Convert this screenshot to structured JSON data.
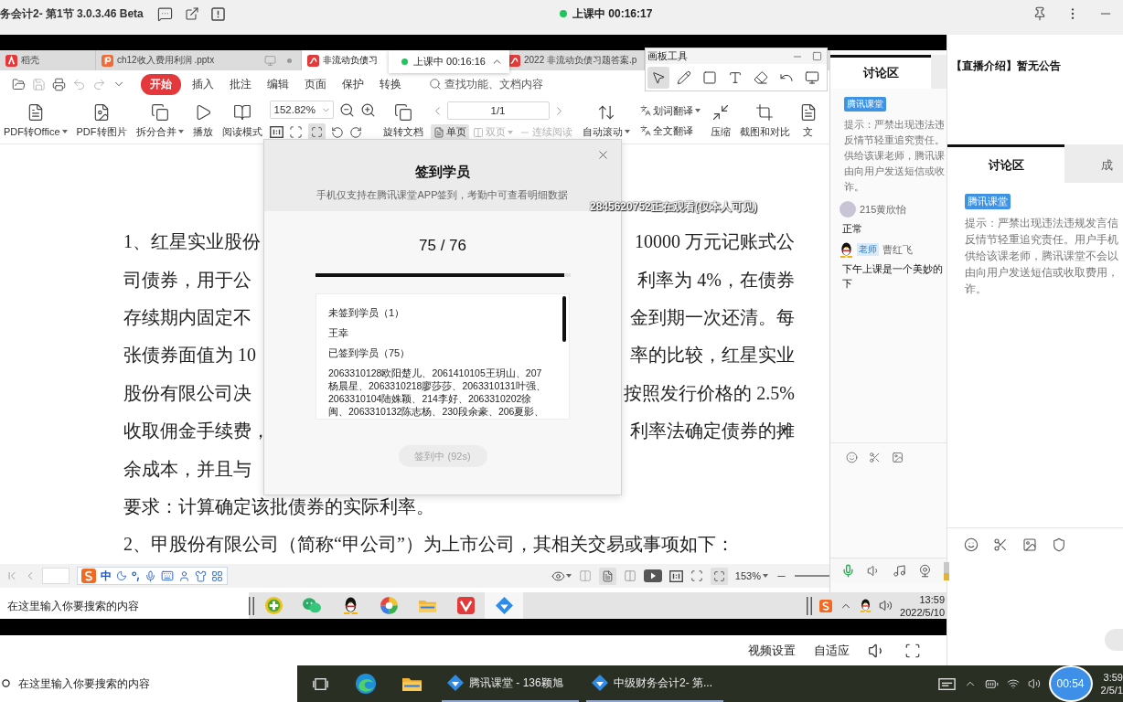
{
  "title_bar": {
    "title": "务会计2- 第1节 3.0.3.46 Beta",
    "class_status": "上课中 00:16:17"
  },
  "shared_screen": {
    "doc_tabs": [
      {
        "label": "稻壳",
        "kind": "docer",
        "selected": false
      },
      {
        "label": "ch12收入费用利润 .pptx",
        "kind": "pptx",
        "selected": false
      },
      {
        "label": "非流动负债习",
        "kind": "pdf",
        "selected": true
      },
      {
        "label": "2022 非流动负债习题答案.p",
        "kind": "pdf",
        "selected": false
      }
    ],
    "class_popup": "上课中 00:16:16",
    "menu": {
      "tabs": [
        {
          "label": "开始",
          "selected": true
        },
        {
          "label": "插入",
          "selected": false
        },
        {
          "label": "批注",
          "selected": false
        },
        {
          "label": "编辑",
          "selected": false
        },
        {
          "label": "页面",
          "selected": false
        },
        {
          "label": "保护",
          "selected": false
        },
        {
          "label": "转换",
          "selected": false
        }
      ],
      "search_placeholder": "查找功能、文档内容"
    },
    "toolbar": {
      "tools": [
        {
          "label": "PDF转Office",
          "dropdown": true
        },
        {
          "label": "PDF转图片",
          "dropdown": false
        },
        {
          "label": "拆分合并",
          "dropdown": true
        },
        {
          "label": "播放",
          "dropdown": false
        },
        {
          "label": "阅读模式",
          "dropdown": false
        }
      ],
      "zoom": "152.82%",
      "rotate_label": "旋转文档",
      "page": "1/1",
      "view_modes": [
        {
          "label": "单页",
          "selected": true,
          "disabled": false,
          "dropdown": false
        },
        {
          "label": "双页",
          "selected": false,
          "disabled": true,
          "dropdown": true
        },
        {
          "label": "连续阅读",
          "selected": false,
          "disabled": true,
          "dropdown": false
        }
      ],
      "auto_scroll": {
        "label": "自动滚动",
        "dropdown": true
      },
      "translate": [
        {
          "label": "划词翻译",
          "dropdown": true
        },
        {
          "label": "全文翻译",
          "dropdown": false
        }
      ],
      "tools_right": [
        {
          "label": "压缩"
        },
        {
          "label": "截图和对比"
        },
        {
          "label": "文"
        }
      ]
    },
    "drawing_tools": {
      "title": "画板工具",
      "tools": [
        {
          "selected": true
        },
        {
          "selected": false
        },
        {
          "selected": false
        },
        {
          "selected": false
        },
        {
          "selected": false
        },
        {
          "selected": false
        },
        {
          "selected": false
        }
      ]
    },
    "document": {
      "lines": [
        {
          "start": "1、红星实业股份",
          "end": "10000 万元记账式公"
        },
        {
          "start": "司债券，用于公",
          "end": "利率为 4%，在债券"
        },
        {
          "start": "存续期内固定不",
          "end": "金到期一次还清。每"
        },
        {
          "start": "张债券面值为 10",
          "end": "率的比较，红星实业"
        },
        {
          "start": "股份有限公司决",
          "end": "按照发行价格的 2.5%"
        },
        {
          "start": "收取佣金手续费，",
          "end": "利率法确定债券的摊"
        },
        {
          "start": "余成本，并且与"
        },
        {
          "start": "要求：计算确定该批债券的实际利率。"
        },
        {
          "start": "2、甲股份有限公司（简称“甲公司”）为上市公司，其相关交易或事项如下："
        }
      ]
    },
    "sign_in_dialog": {
      "title": "签到学员",
      "subtitle": "手机仅支持在腾讯课堂APP签到，考勤中可查看明细数据",
      "count": "75 / 76",
      "progress": {
        "level": 0.975
      },
      "absent_heading": "未签到学员（1）",
      "absent_names": "王幸",
      "present_heading": "已签到学员（75）",
      "present_lines": [
        "2063310128欧阳楚儿、2061410105王玥山、207",
        "杨晨星、2063310218廖莎莎、2063310131叶强、",
        "2063310104陆姝颖、214李好、2063310202徐",
        "闽、2063310132陈志杨、230段余豪、206夏影、"
      ],
      "button": {
        "label": "签到中 (92s)",
        "disabled": true
      }
    },
    "viewer_notice": "2845620752正在观看(仅本人可见)",
    "status_bar": {
      "ime_mode": "中",
      "zoom": "153%"
    },
    "chat_panel": {
      "tab": "讨论区",
      "badge": "腾讯课堂",
      "notice_lines": [
        "提示：严禁出现违法违",
        "反情节轻重追究责任。",
        "供给该课老师，腾讯课",
        "由向用户发送短信或收",
        "诈。"
      ],
      "messages": [
        {
          "kind": "student",
          "name": "215黄欣怡",
          "lines": [
            "正常"
          ]
        },
        {
          "kind": "teacher",
          "role": "老师",
          "name": "曹红飞",
          "lines": [
            "下午上课是一个美妙的",
            "下"
          ]
        }
      ]
    },
    "taskbar": {
      "search_placeholder": "在这里输入你要搜索的内容",
      "time": "13:59",
      "date": "2022/5/10"
    }
  },
  "video_controls": {
    "buttons": [
      "视频设置",
      "自适应"
    ]
  },
  "side_panel": {
    "announcement": "【直播介绍】暂无公告",
    "tabs": [
      {
        "label": "讨论区",
        "selected": true
      },
      {
        "label": "成",
        "selected": false
      }
    ],
    "badge": "腾讯课堂",
    "notice_lines": [
      "提示：严禁出现违法违规发言信",
      "反情节轻重追究责任。用户手机",
      "供给该课老师，腾讯课堂不会以",
      "由向用户发送短信或收取费用，",
      "诈。"
    ]
  },
  "taskbar": {
    "search_placeholder": "在这里输入你要搜索的内容",
    "apps": [
      {
        "label": "腾讯课堂 - 136颖旭"
      },
      {
        "label": "中级财务会计2- 第..."
      }
    ],
    "timer": "00:54",
    "time": "3:59",
    "date": "2/5/1"
  }
}
